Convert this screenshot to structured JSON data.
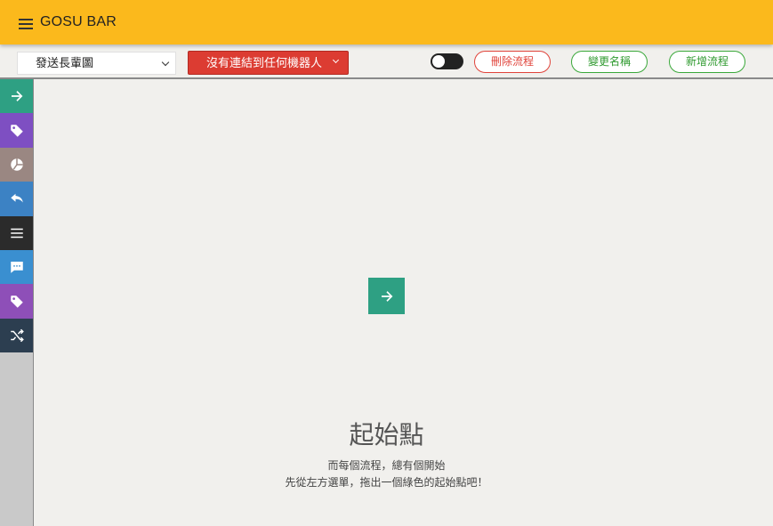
{
  "app": {
    "title": "GOSU BAR"
  },
  "toolbar": {
    "flow_select_value": "發送長輩圖",
    "bot_select_value": "沒有連結到任何機器人",
    "delete_label": "刪除流程",
    "rename_label": "變更名稱",
    "add_label": "新增流程",
    "toggle_on": false
  },
  "sidebar": {
    "items": [
      {
        "icon": "arrow-right-icon",
        "color": "#2ea083"
      },
      {
        "icon": "tag-icon",
        "color": "#7e4fc2"
      },
      {
        "icon": "pie-chart-icon",
        "color": "#9a8782"
      },
      {
        "icon": "reply-icon",
        "color": "#3c82c4"
      },
      {
        "icon": "menu-lines-icon",
        "color": "#2b2b2b"
      },
      {
        "icon": "chat-bubble-icon",
        "color": "#3a8fd0"
      },
      {
        "icon": "tag-icon",
        "color": "#8e4fb8"
      },
      {
        "icon": "shuffle-icon",
        "color": "#2c3e50"
      }
    ]
  },
  "canvas": {
    "start_title": "起始點",
    "hint_line1": "而每個流程，總有個開始",
    "hint_line2": "先從左方選單，拖出一個綠色的起始點吧！",
    "start_block_color": "#2ea083"
  },
  "colors": {
    "appbar": "#fbb91c",
    "danger": "#dc3c32",
    "success": "#3aa83a"
  }
}
